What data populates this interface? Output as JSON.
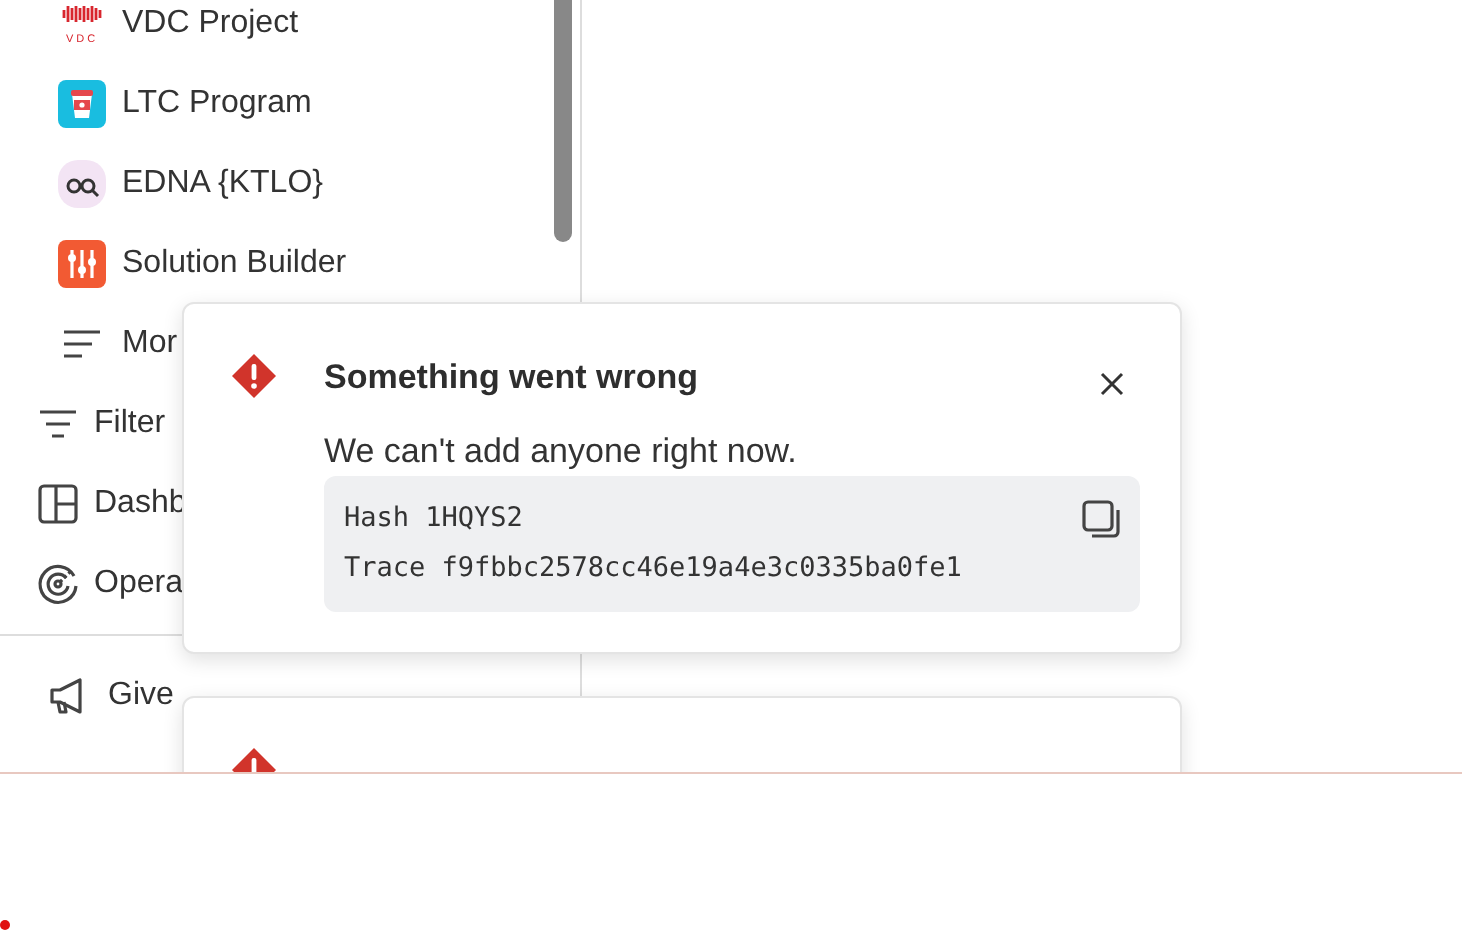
{
  "sidebar": {
    "projects": [
      {
        "kind": "vdc",
        "label": "VDC Project",
        "logo_text": "VDC"
      },
      {
        "kind": "cup",
        "label": "LTC Program"
      },
      {
        "kind": "glasses",
        "label": "EDNA {KTLO}"
      },
      {
        "kind": "sliders",
        "label": "Solution Builder"
      },
      {
        "kind": "more",
        "label": "Mor"
      }
    ],
    "nav": [
      {
        "kind": "filter",
        "label": "Filter"
      },
      {
        "kind": "dashboard",
        "label": "Dashb"
      },
      {
        "kind": "radar",
        "label": "Opera"
      }
    ],
    "footer": {
      "kind": "megaphone",
      "label": "Give"
    }
  },
  "toasts": [
    {
      "kind": "error",
      "title": "Something went wrong",
      "message": "We can't add anyone right now.",
      "details": [
        "Hash 1HQYS2",
        "Trace f9fbbc2578cc46e19a4e3c0335ba0fe1"
      ]
    },
    {
      "kind": "error"
    }
  ]
}
